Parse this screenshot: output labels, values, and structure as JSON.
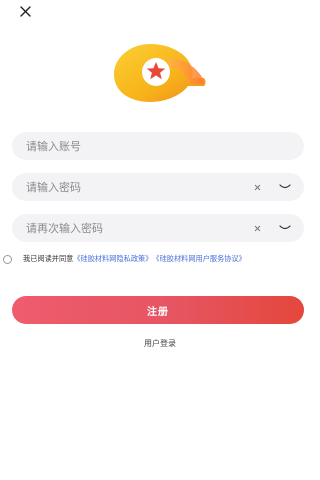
{
  "header": {
    "close_icon": "close-icon"
  },
  "logo": {
    "icon": "app-logo-star",
    "colors": {
      "primary": "#f7b21a",
      "accent": "#ff7a2e",
      "star": "#e8483a"
    }
  },
  "form": {
    "account": {
      "placeholder": "请输入账号",
      "value": ""
    },
    "password": {
      "placeholder": "请输入密码",
      "value": "",
      "clear_icon": "clear-icon",
      "visibility_icon": "eye-closed-icon"
    },
    "confirm_password": {
      "placeholder": "请再次输入密码",
      "value": "",
      "clear_icon": "clear-icon",
      "visibility_icon": "eye-closed-icon"
    }
  },
  "agreement": {
    "prefix": "我已阅读并同意",
    "privacy_link": "《硅胶材料网隐私政策》",
    "service_link": "《硅胶材料网用户服务协议》",
    "checked": false
  },
  "actions": {
    "register_label": "注册",
    "login_label": "用户登录"
  },
  "colors": {
    "button_gradient_start": "#ee5c6e",
    "button_gradient_end": "#e4473c",
    "link": "#4a6fd8",
    "field_bg": "#f3f3f5"
  }
}
